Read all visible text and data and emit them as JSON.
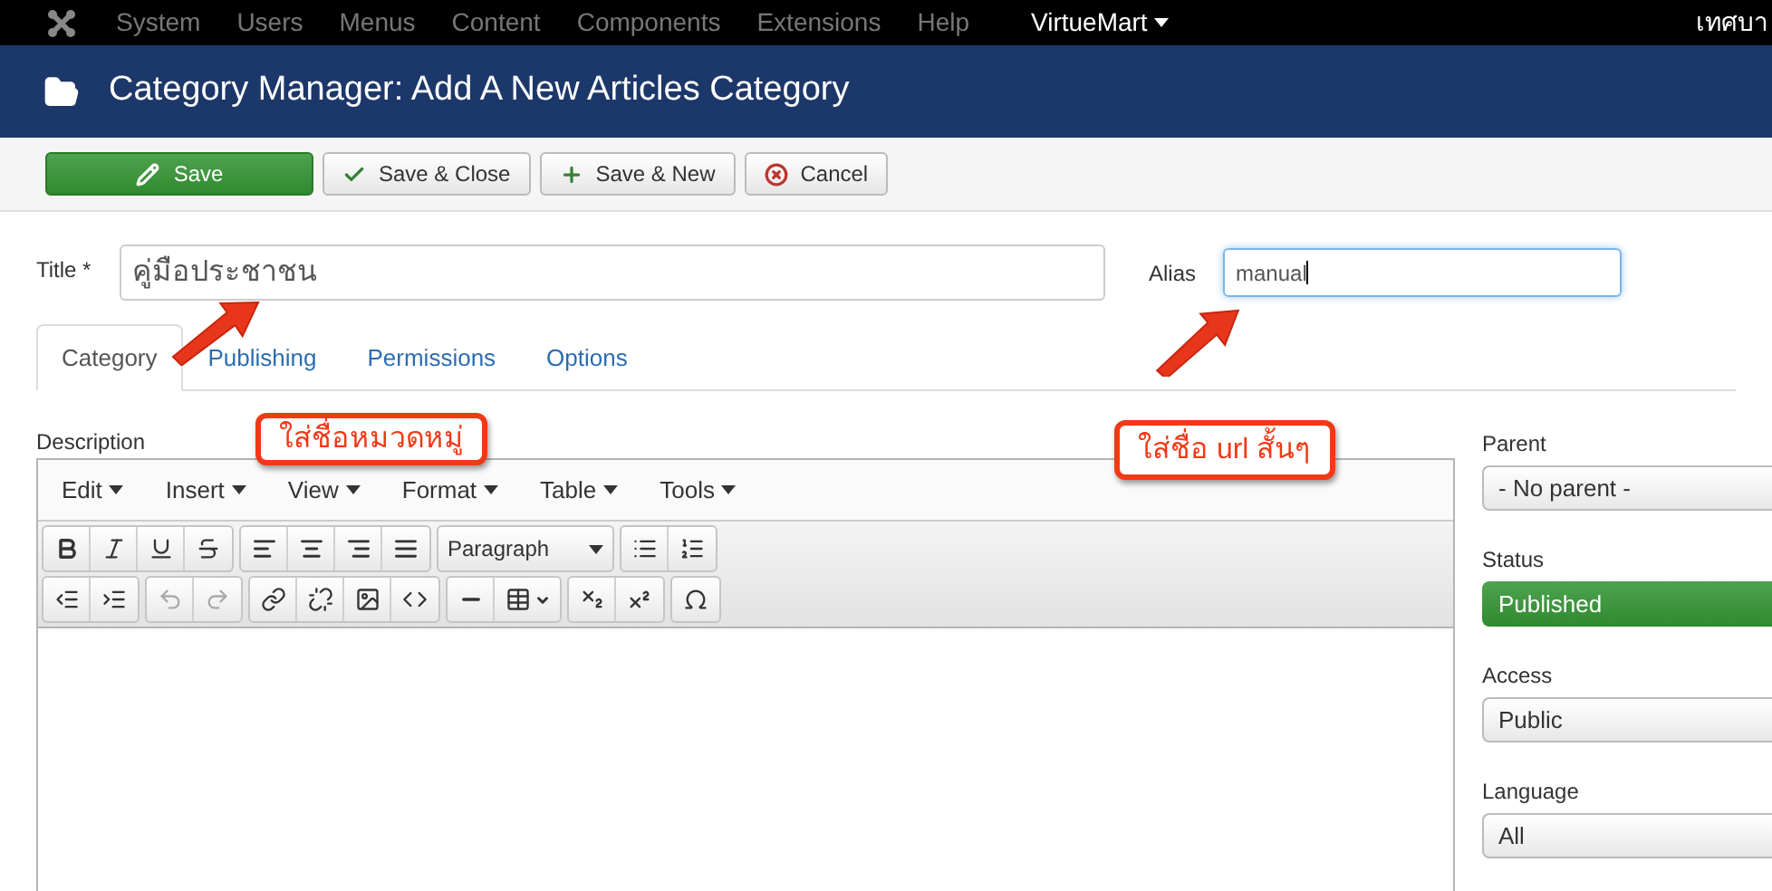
{
  "top_menu": {
    "items": [
      {
        "label": "System",
        "kind": "plain"
      },
      {
        "label": "Users",
        "kind": "plain"
      },
      {
        "label": "Menus",
        "kind": "plain"
      },
      {
        "label": "Content",
        "kind": "plain"
      },
      {
        "label": "Components",
        "kind": "plain"
      },
      {
        "label": "Extensions",
        "kind": "plain"
      },
      {
        "label": "Help",
        "kind": "plain"
      },
      {
        "label": "VirtueMart",
        "kind": "dropdown"
      }
    ],
    "user": "เทศบา"
  },
  "header": {
    "title": "Category Manager: Add A New Articles Category"
  },
  "toolbar": {
    "buttons": [
      {
        "label": "Save",
        "kind": "primary"
      },
      {
        "label": "Save & Close",
        "kind": "default"
      },
      {
        "label": "Save & New",
        "kind": "default"
      },
      {
        "label": "Cancel",
        "kind": "default"
      }
    ]
  },
  "form": {
    "title": {
      "label": "Title *",
      "value": "คู่มือประชาชน"
    },
    "alias": {
      "label": "Alias",
      "value": "manual",
      "focused": true
    }
  },
  "tabs": [
    {
      "label": "Category",
      "selected": true
    },
    {
      "label": "Publishing",
      "selected": false
    },
    {
      "label": "Permissions",
      "selected": false
    },
    {
      "label": "Options",
      "selected": false
    }
  ],
  "description": {
    "label": "Description",
    "editor_menus": [
      "Edit",
      "Insert",
      "View",
      "Format",
      "Table",
      "Tools"
    ],
    "format_select": "Paragraph"
  },
  "sidebar": [
    {
      "label": "Parent",
      "value": "- No parent -",
      "kind": "select"
    },
    {
      "label": "Status",
      "value": "Published",
      "kind": "status"
    },
    {
      "label": "Access",
      "value": "Public",
      "kind": "select"
    },
    {
      "label": "Language",
      "value": "All",
      "kind": "select"
    }
  ],
  "annotations": [
    {
      "text": "ใส่ชื่อหมวดหมู่"
    },
    {
      "text": "ใส่ชื่อ url สั้นๆ"
    }
  ]
}
